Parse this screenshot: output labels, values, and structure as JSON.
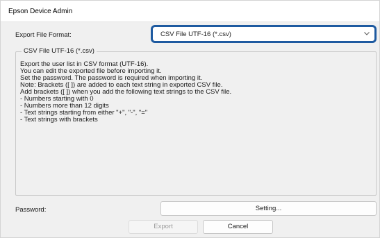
{
  "window": {
    "title": "Epson Device Admin"
  },
  "export_format": {
    "label": "Export File Format:",
    "selected": "CSV File UTF-16 (*.csv)",
    "accent_color": "#1e5aa0",
    "icon": "chevron-down-icon"
  },
  "group": {
    "title": "CSV File UTF-16 (*.csv)",
    "lines": [
      "Export the user list in CSV format (UTF-16).",
      "You can edit the exported file before importing it.",
      "Set the password. The password is required when importing it.",
      "Note: Brackets ([ ]) are added to each text string in exported CSV file.",
      "Add brackets ([ ]) when you add the following text strings to the CSV file.",
      "- Numbers starting with 0",
      "- Numbers more than 12 digits",
      "- Text strings starting from either \"+\", \"-\", \"=\"",
      "- Text strings with brackets"
    ]
  },
  "password": {
    "label": "Password:",
    "setting_button": "Setting..."
  },
  "buttons": {
    "export": "Export",
    "cancel": "Cancel"
  }
}
